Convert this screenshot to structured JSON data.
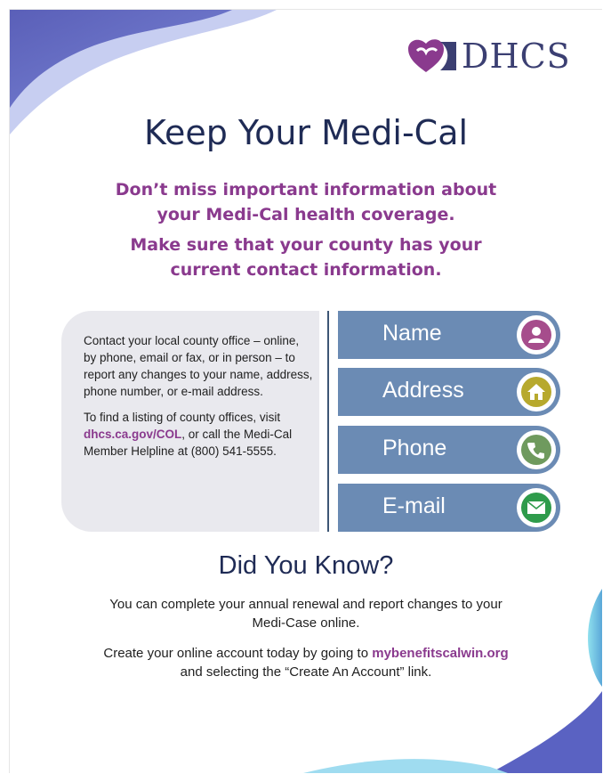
{
  "logo": {
    "text": "DHCS"
  },
  "title": "Keep Your Medi-Cal",
  "subtitle_1": "Don’t miss important information about your Medi-Cal health coverage.",
  "subtitle_2": "Make sure that your county has your current contact information.",
  "contact": {
    "paragraph_1": "Contact your local county office – online, by phone, email or fax, or in person – to report any changes to your name, address, phone number, or e-mail address.",
    "paragraph_2_before": "To find a listing of county offices, visit ",
    "paragraph_2_link": "dhcs.ca.gov/COL",
    "paragraph_2_after": ", or call the Medi-Cal Member Helpline at (800) 541-5555."
  },
  "fields": [
    {
      "label": "Name",
      "icon": "person-icon",
      "color": "#a64d8c"
    },
    {
      "label": "Address",
      "icon": "home-icon",
      "color": "#b7a92d"
    },
    {
      "label": "Phone",
      "icon": "phone-icon",
      "color": "#6f9a5e"
    },
    {
      "label": "E-mail",
      "icon": "envelope-icon",
      "color": "#2e9b4b"
    }
  ],
  "did_you_know": {
    "title": "Did You Know?",
    "text_1": "You can complete your annual renewal and report changes to your Medi-Case online.",
    "text_2_before": "Create your online account today by going to ",
    "text_2_link": "mybenefitscalwin.org",
    "text_2_after": " and selecting the “Create An Account” link."
  },
  "colors": {
    "title": "#1f2b55",
    "accent": "#8a3a8e",
    "field": "#6b8bb4"
  }
}
